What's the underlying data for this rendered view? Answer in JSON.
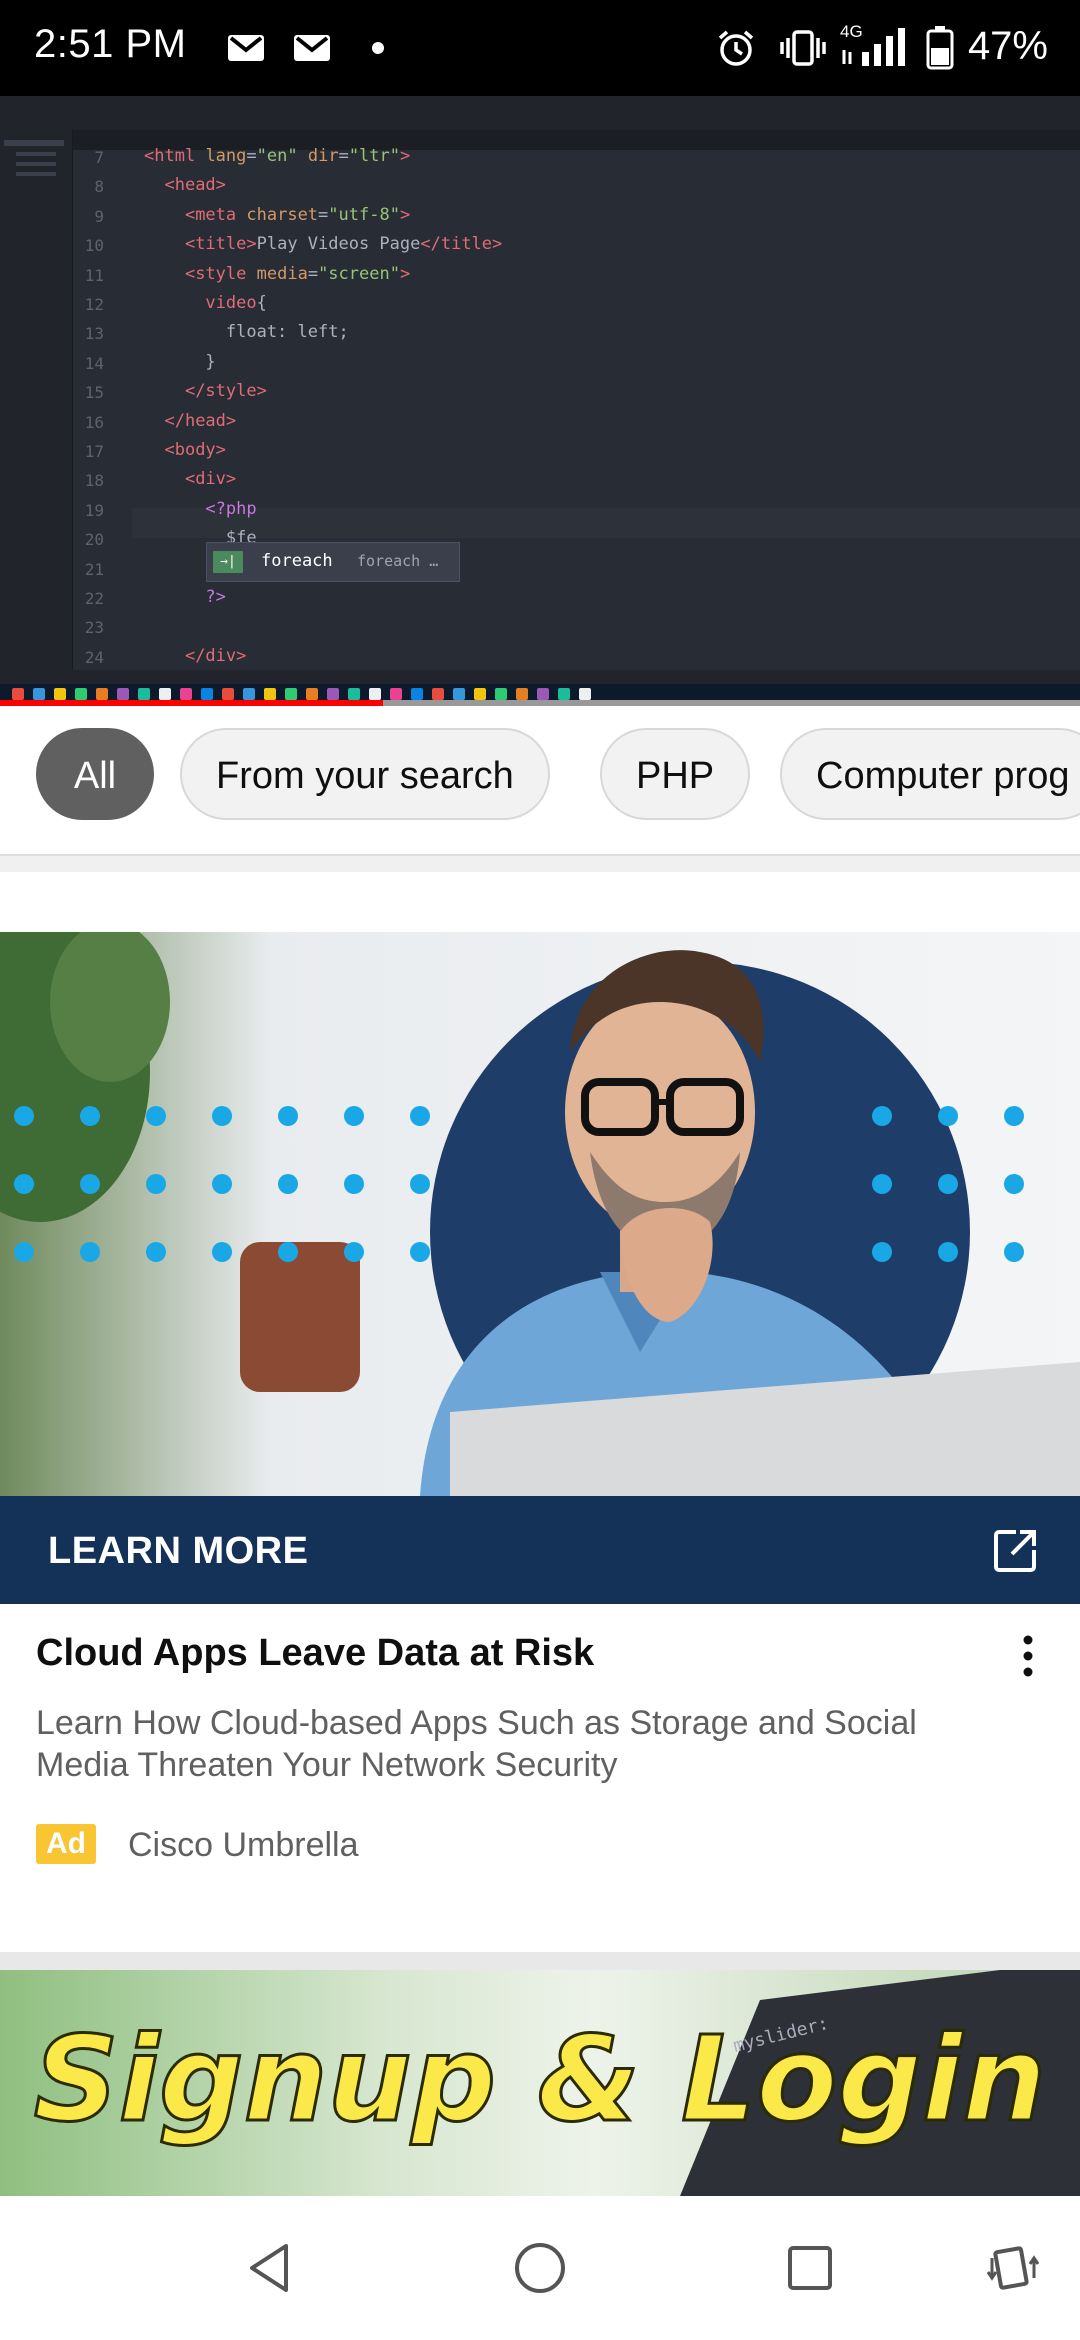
{
  "status_bar": {
    "time": "2:51 PM",
    "battery_percent": "47%",
    "network": "4G",
    "icons": [
      "gmail-icon",
      "gmail-icon",
      "dot-icon",
      "alarm-icon",
      "vibrate-icon",
      "signal-icon",
      "battery-icon"
    ]
  },
  "video_player": {
    "code_lines": [
      {
        "num": "7",
        "html": "<span class=\"tag\">&lt;html</span> <span class=\"attr\">lang</span>=<span class=\"str\">\"en\"</span> <span class=\"attr\">dir</span>=<span class=\"str\">\"ltr\"</span><span class=\"tag\">&gt;</span>"
      },
      {
        "num": "8",
        "html": "  <span class=\"tag\">&lt;head&gt;</span>"
      },
      {
        "num": "9",
        "html": "    <span class=\"tag\">&lt;meta</span> <span class=\"attr\">charset</span>=<span class=\"str\">\"utf-8\"</span><span class=\"tag\">&gt;</span>"
      },
      {
        "num": "10",
        "html": "    <span class=\"tag\">&lt;title&gt;</span>Play Videos Page<span class=\"tag\">&lt;/title&gt;</span>"
      },
      {
        "num": "11",
        "html": "    <span class=\"tag\">&lt;style</span> <span class=\"attr\">media</span>=<span class=\"str\">\"screen\"</span><span class=\"tag\">&gt;</span>"
      },
      {
        "num": "12",
        "html": "      <span class=\"tag\">video</span>{"
      },
      {
        "num": "13",
        "html": "        float: left;"
      },
      {
        "num": "14",
        "html": "      }"
      },
      {
        "num": "15",
        "html": "    <span class=\"tag\">&lt;/style&gt;</span>"
      },
      {
        "num": "16",
        "html": "  <span class=\"tag\">&lt;/head&gt;</span>"
      },
      {
        "num": "17",
        "html": "  <span class=\"tag\">&lt;body&gt;</span>"
      },
      {
        "num": "18",
        "html": "    <span class=\"tag\">&lt;div&gt;</span>"
      },
      {
        "num": "19",
        "html": "      <span class=\"kw\">&lt;?php</span>"
      },
      {
        "num": "20",
        "html": "        $fe"
      },
      {
        "num": "21",
        "html": ""
      },
      {
        "num": "22",
        "html": "      <span class=\"kw\">?&gt;</span>"
      },
      {
        "num": "23",
        "html": ""
      },
      {
        "num": "24",
        "html": "    <span class=\"tag\">&lt;/div&gt;</span>"
      }
    ],
    "autocomplete": {
      "icon": "→|",
      "keyword": "foreach",
      "description": "foreach …"
    },
    "progress_fraction": 0.355
  },
  "chips": [
    {
      "label": "All",
      "active": true
    },
    {
      "label": "From your search",
      "active": false
    },
    {
      "label": "PHP",
      "active": false
    },
    {
      "label": "Computer prog",
      "active": false
    }
  ],
  "ad": {
    "cta": "LEARN MORE",
    "title": "Cloud Apps Leave Data at Risk",
    "description": "Learn How Cloud-based Apps Such as Storage and Social Media Threaten Your Network Security",
    "badge": "Ad",
    "advertiser": "Cisco Umbrella"
  },
  "next_video": {
    "thumbnail_text": "Signup & Login",
    "code_snippet": "myslider:"
  },
  "colors": {
    "learn_more_bg": "#143258",
    "ad_badge": "#f9c533",
    "progress": "#ff0000",
    "dots": "#1aa7e6"
  }
}
